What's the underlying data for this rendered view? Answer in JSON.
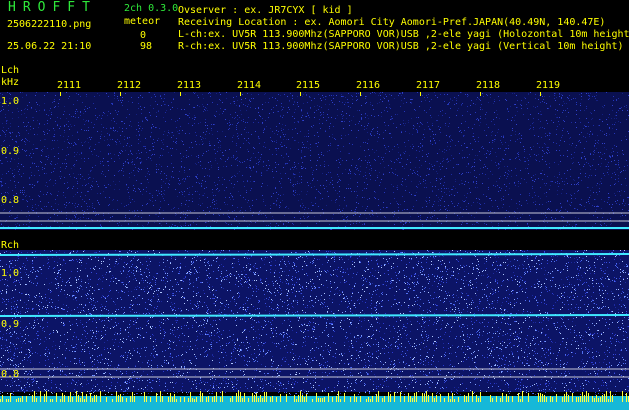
{
  "header": {
    "app_title": "HROFFT",
    "version": "2ch 0.3.0",
    "filename": "2506222110.png",
    "meteor_label": "meteor",
    "datetime": "25.06.22 21:10",
    "meteor_count_l": "0",
    "meteor_count_r": "98"
  },
  "info": {
    "observer": "Ovserver            : ex. JR7CYX [ kid ]",
    "location": "Receiving Location : ex. Aomori City Aomori-Pref.JAPAN(40.49N, 140.47E)",
    "lch": "L-ch:ex. UV5R 113.900Mhz(SAPPORO VOR)USB ,2-ele yagi (Holozontal 10m height)",
    "rch": "R-ch:ex. UV5R 113.900Mhz(SAPPORO VOR)USB ,2-ele yagi (Vertical 10m height)"
  },
  "lch_panel": {
    "label": "Lch",
    "unit": "kHz",
    "ticks": [
      "1.0",
      "0.9",
      "0.8"
    ],
    "minutes": [
      "2111",
      "2112",
      "2113",
      "2114",
      "2115",
      "2116",
      "2117",
      "2118",
      "2119"
    ]
  },
  "rch_panel": {
    "label": "Rch",
    "ticks": [
      "1.0",
      "0.9",
      "0.8"
    ]
  },
  "colors": {
    "background": "#000000",
    "text_yellow": "#ffff00",
    "text_green": "#2ee83a",
    "noise_blue": "#1a2a90",
    "signal_cyan": "#40e8ff",
    "reference_line": "#c8c8d8"
  }
}
